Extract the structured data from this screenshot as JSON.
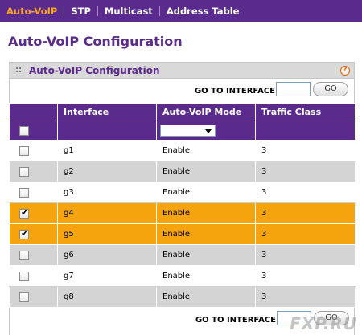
{
  "nav": {
    "items": [
      {
        "label": "Auto-VoIP",
        "active": true
      },
      {
        "label": "STP",
        "active": false
      },
      {
        "label": "Multicast",
        "active": false
      },
      {
        "label": "Address Table",
        "active": false
      }
    ]
  },
  "page_title": "Auto-VoIP Configuration",
  "panel": {
    "title": "Auto-VoIP Configuration",
    "help_icon": "?",
    "goto_label": "GO TO INTERFACE",
    "go_button": "GO"
  },
  "table": {
    "columns": [
      "",
      "Interface",
      "Auto-VoIP Mode",
      "Traffic Class"
    ],
    "rows": [
      {
        "checked": false,
        "interface": "g1",
        "mode": "Enable",
        "traffic_class": "3"
      },
      {
        "checked": false,
        "interface": "g2",
        "mode": "Enable",
        "traffic_class": "3"
      },
      {
        "checked": false,
        "interface": "g3",
        "mode": "Enable",
        "traffic_class": "3"
      },
      {
        "checked": true,
        "interface": "g4",
        "mode": "Enable",
        "traffic_class": "3"
      },
      {
        "checked": true,
        "interface": "g5",
        "mode": "Enable",
        "traffic_class": "3"
      },
      {
        "checked": false,
        "interface": "g6",
        "mode": "Enable",
        "traffic_class": "3"
      },
      {
        "checked": false,
        "interface": "g7",
        "mode": "Enable",
        "traffic_class": "3"
      },
      {
        "checked": false,
        "interface": "g8",
        "mode": "Enable",
        "traffic_class": "3"
      }
    ]
  },
  "bottom": {
    "goto_label": "GO TO INTERFACE",
    "go_button": "GO"
  },
  "watermark": "FXP.RU",
  "colors": {
    "brand_purple": "#5a2a8c",
    "active_nav": "#f5a623",
    "selected_row": "#f5a40d",
    "alt_row": "#d4d4d4"
  }
}
